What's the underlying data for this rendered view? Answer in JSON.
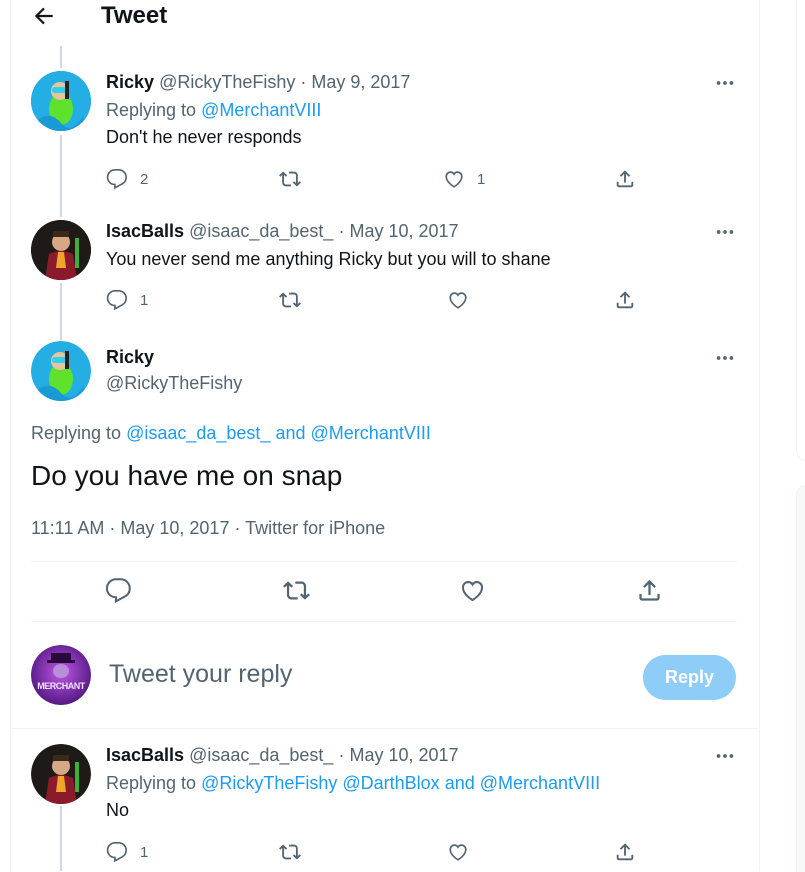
{
  "header": {
    "title": "Tweet"
  },
  "tweets": [
    {
      "name": "Ricky",
      "handle": "@RickyTheFishy",
      "date": "· May 9, 2017",
      "replying_prefix": "Replying to",
      "replying_to": "@MerchantVIII",
      "text": "Don't he never responds",
      "reply_count": "2",
      "retweet_count": "",
      "like_count": "1"
    },
    {
      "name": "IsacBalls",
      "handle": "@isaac_da_best_",
      "date": "· May 10, 2017",
      "text": "You never send me anything Ricky but you will to shane",
      "reply_count": "1",
      "retweet_count": "",
      "like_count": ""
    }
  ],
  "main_tweet": {
    "name": "Ricky",
    "handle": "@RickyTheFishy",
    "replying_prefix": "Replying to",
    "replying_to_1": "@isaac_da_best_",
    "replying_and": "and",
    "replying_to_2": "@MerchantVIII",
    "text": "Do you have me on snap",
    "meta": "11:11 AM · May 10, 2017 · Twitter for iPhone"
  },
  "compose": {
    "placeholder": "Tweet your reply",
    "reply_button": "Reply",
    "avatar_text": "MERCHANT"
  },
  "bottom_tweet": {
    "name": "IsacBalls",
    "handle": "@isaac_da_best_",
    "date": "· May 10, 2017",
    "replying_prefix": "Replying to",
    "replying_to": "@RickyTheFishy @DarthBlox",
    "replying_and": "and",
    "replying_to_2": "@MerchantVIII",
    "text": "No",
    "reply_count": "1"
  },
  "colors": {
    "accent": "#1d9bf0",
    "muted": "#536471",
    "reply_button_bg": "#8ecdf8"
  },
  "icons": [
    "back-arrow-icon",
    "more-icon",
    "reply-icon",
    "retweet-icon",
    "like-icon",
    "share-icon"
  ]
}
